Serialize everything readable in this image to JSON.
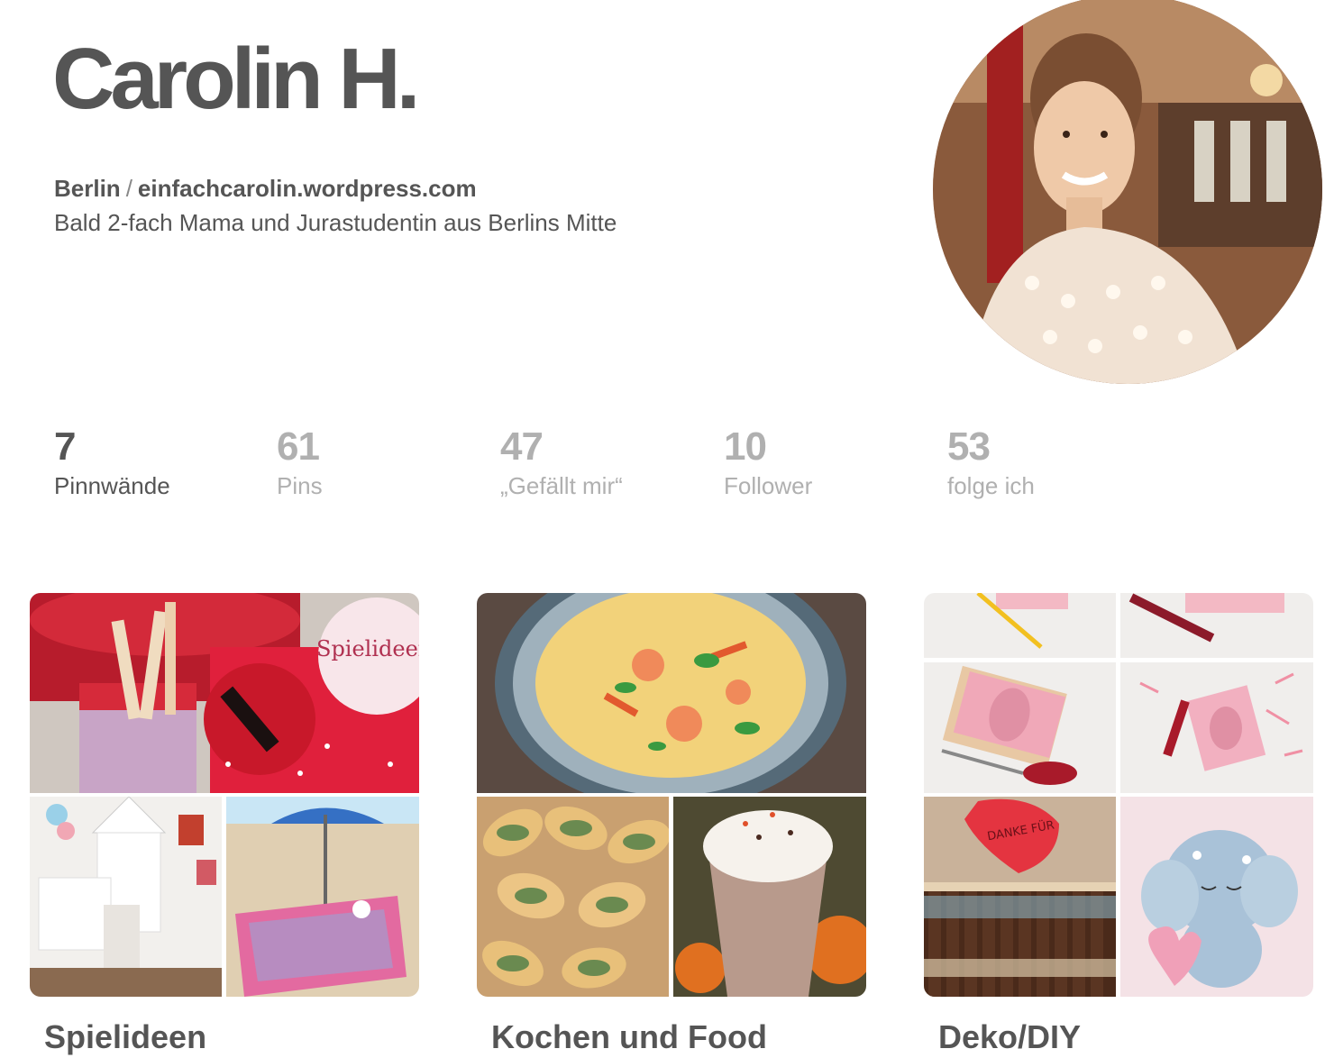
{
  "profile": {
    "name": "Carolin H.",
    "location": "Berlin",
    "separator": "/",
    "website": "einfachcarolin.wordpress.com",
    "bio": "Bald 2-fach Mama und Jurastudentin aus Berlins Mitte"
  },
  "stats": [
    {
      "value": "7",
      "label": "Pinnwände"
    },
    {
      "value": "61",
      "label": "Pins"
    },
    {
      "value": "47",
      "label": "„Gefällt mir“"
    },
    {
      "value": "10",
      "label": "Follower"
    },
    {
      "value": "53",
      "label": "folge ich"
    }
  ],
  "boards": [
    {
      "title": "Spielideen",
      "cover_text": "Spielideen der Woche"
    },
    {
      "title": "Kochen und Food"
    },
    {
      "title": "Deko/DIY",
      "cover_text": "DANKE FÜR"
    }
  ]
}
